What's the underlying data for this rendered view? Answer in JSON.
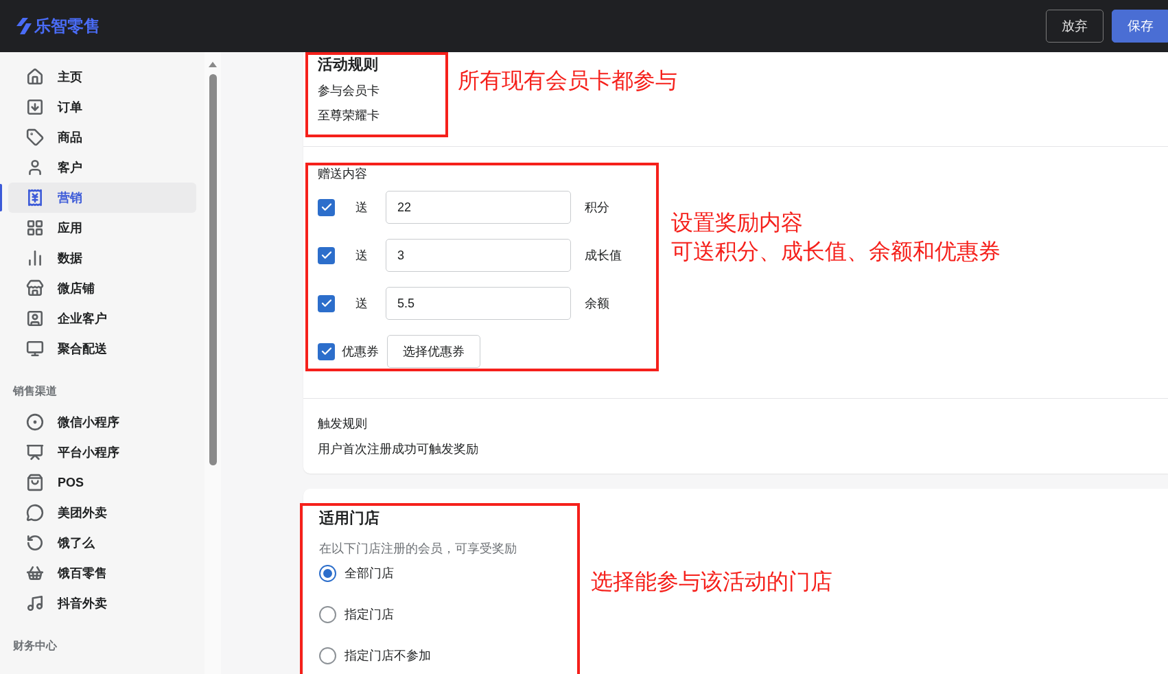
{
  "header": {
    "logo": "乐智零售",
    "buttons": [
      {
        "label": "放弃",
        "kind": "secondary"
      },
      {
        "label": "保存",
        "kind": "primary"
      }
    ]
  },
  "sidebar": {
    "sections": [
      {
        "items": [
          {
            "label": "主页",
            "selected": false
          },
          {
            "label": "订单",
            "selected": false
          },
          {
            "label": "商品",
            "selected": false
          },
          {
            "label": "客户",
            "selected": false
          },
          {
            "label": "营销",
            "selected": true
          },
          {
            "label": "应用",
            "selected": false
          },
          {
            "label": "数据",
            "selected": false
          },
          {
            "label": "微店铺",
            "selected": false
          },
          {
            "label": "企业客户",
            "selected": false
          },
          {
            "label": "聚合配送",
            "selected": false
          }
        ]
      },
      {
        "title": "销售渠道",
        "items": [
          {
            "label": "微信小程序",
            "selected": false
          },
          {
            "label": "平台小程序",
            "selected": false
          },
          {
            "label": "POS",
            "selected": false
          },
          {
            "label": "美团外卖",
            "selected": false
          },
          {
            "label": "饿了么",
            "selected": false
          },
          {
            "label": "饿百零售",
            "selected": false
          },
          {
            "label": "抖音外卖",
            "selected": false
          }
        ]
      },
      {
        "title": "财务中心"
      }
    ]
  },
  "activity_rules": {
    "title": "活动规则",
    "label": "参与会员卡",
    "value": "至尊荣耀卡",
    "annotation": "所有现有会员卡都参与"
  },
  "gift_content": {
    "title": "赠送内容",
    "rows": [
      {
        "kind": "input",
        "checked": true,
        "prefix": "送",
        "value": "22",
        "unit": "积分"
      },
      {
        "kind": "input",
        "checked": true,
        "prefix": "送",
        "value": "3",
        "unit": "成长值"
      },
      {
        "kind": "input",
        "checked": true,
        "prefix": "送",
        "value": "5.5",
        "unit": "余额"
      },
      {
        "kind": "button",
        "checked": true,
        "label": "优惠券",
        "button": "选择优惠券"
      }
    ],
    "annotation": [
      "设置奖励内容",
      "可送积分、成长值、余额和优惠券"
    ]
  },
  "trigger_rules": {
    "title": "触发规则",
    "text": "用户首次注册成功可触发奖励"
  },
  "stores": {
    "title": "适用门店",
    "hint": "在以下门店注册的会员，可享受奖励",
    "options": [
      {
        "label": "全部门店",
        "selected": true
      },
      {
        "label": "指定门店",
        "selected": false
      },
      {
        "label": "指定门店不参加",
        "selected": false
      }
    ],
    "annotation": "选择能参与该活动的门店"
  }
}
